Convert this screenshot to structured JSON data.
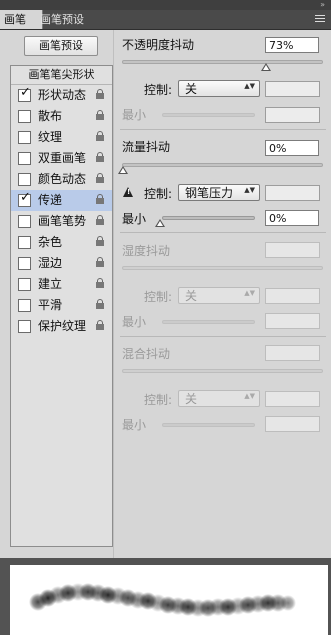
{
  "panel": {
    "collapse_glyph": "»",
    "tabs": [
      {
        "label": "画笔"
      },
      {
        "label": "画笔预设"
      }
    ],
    "menu_icon": "panel-menu-icon"
  },
  "brush_preset_button": "画笔预设",
  "list": {
    "header": "画笔笔尖形状",
    "items": [
      {
        "label": "形状动态",
        "checked": true,
        "lock": "lock-icon"
      },
      {
        "label": "散布",
        "checked": false,
        "lock": "lock-icon"
      },
      {
        "label": "纹理",
        "checked": false,
        "lock": "lock-icon"
      },
      {
        "label": "双重画笔",
        "checked": false,
        "lock": "lock-icon"
      },
      {
        "label": "颜色动态",
        "checked": false,
        "lock": "lock-icon"
      },
      {
        "label": "传递",
        "checked": true,
        "selected": true,
        "lock": "lock-icon"
      },
      {
        "label": "画笔笔势",
        "checked": false,
        "lock": "lock-icon"
      },
      {
        "label": "杂色",
        "checked": false,
        "lock": "lock-icon"
      },
      {
        "label": "湿边",
        "checked": false,
        "lock": "lock-icon"
      },
      {
        "label": "建立",
        "checked": false,
        "lock": "lock-icon"
      },
      {
        "label": "平滑",
        "checked": false,
        "lock": "lock-icon"
      },
      {
        "label": "保护纹理",
        "checked": false,
        "lock": "lock-icon"
      }
    ],
    "check_glyph": "✓"
  },
  "opacity_jitter": {
    "label": "不透明度抖动",
    "value": "73%",
    "slider_fraction": 0.73,
    "control_label": "控制:",
    "control_value": "关",
    "min_label": "最小"
  },
  "flow_jitter": {
    "label": "流量抖动",
    "value": "0%",
    "slider_fraction": 0.0,
    "control_label": "控制:",
    "control_value": "钢笔压力",
    "warning_glyph": "!",
    "min_label": "最小",
    "min_value": "0%",
    "min_fraction": 0.0
  },
  "wetness_jitter": {
    "label": "湿度抖动",
    "control_label": "控制:",
    "control_value": "关",
    "min_label": "最小"
  },
  "mix_jitter": {
    "label": "混合抖动",
    "control_label": "控制:",
    "control_value": "关",
    "min_label": "最小"
  },
  "updown_glyph": "▲▼",
  "colors": {
    "panel_bg": "#d6d6d6",
    "selected_row": "#b9cbe9",
    "disabled_text": "#9a9a9a"
  }
}
